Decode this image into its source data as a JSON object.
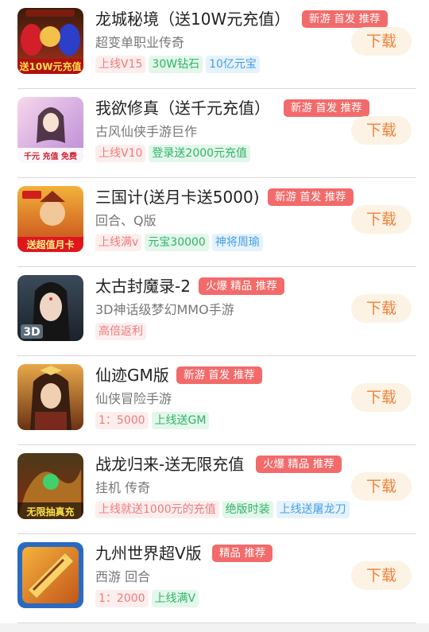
{
  "download_label": "下载",
  "games": [
    {
      "title": "龙城秘境（送10W元充值）",
      "badge": "新游 首发 推荐",
      "subtitle": "超变单职业传奇",
      "tags": [
        {
          "text": "上线V15",
          "color": "red"
        },
        {
          "text": "30W钻石",
          "color": "green"
        },
        {
          "text": "10亿元宝",
          "color": "blue"
        }
      ],
      "icon_caption": "送10W元充值",
      "icon_name": "longcheng-game-icon"
    },
    {
      "title": "我欲修真（送千元充值）",
      "badge": "新游 首发 推荐",
      "subtitle": "古风仙侠手游巨作",
      "tags": [
        {
          "text": "上线V10",
          "color": "red"
        },
        {
          "text": "登录送2000元充值",
          "color": "green"
        }
      ],
      "icon_caption": "千元 充值 免费",
      "icon_name": "xiuzhen-game-icon"
    },
    {
      "title": "三国计(送月卡送5000)",
      "badge": "新游 首发 推荐",
      "subtitle": "回合、Q版",
      "tags": [
        {
          "text": "上线满v",
          "color": "red"
        },
        {
          "text": "元宝30000",
          "color": "green"
        },
        {
          "text": "神将周瑜",
          "color": "blue"
        }
      ],
      "icon_caption": "送超值月卡",
      "icon_name": "sanguoji-game-icon"
    },
    {
      "title": "太古封魔录-2",
      "badge": "火爆 精品 推荐",
      "subtitle": "3D神话级梦幻MMO手游",
      "tags": [
        {
          "text": "高倍返利",
          "color": "red"
        }
      ],
      "icon_caption": "3D",
      "icon_name": "taigu-game-icon"
    },
    {
      "title": "仙迹GM版",
      "badge": "新游 首发 推荐",
      "subtitle": "仙侠冒险手游",
      "tags": [
        {
          "text": "1：5000",
          "color": "red"
        },
        {
          "text": "上线送GM",
          "color": "green"
        }
      ],
      "icon_caption": "",
      "icon_name": "xianji-game-icon"
    },
    {
      "title": "战龙归来-送无限充值",
      "badge": "火爆 精品 推荐",
      "subtitle": "挂机 传奇",
      "tags": [
        {
          "text": "上线就送1000元的充值",
          "color": "red"
        },
        {
          "text": "绝版时装",
          "color": "green"
        },
        {
          "text": "上线送屠龙刀",
          "color": "blue"
        }
      ],
      "icon_caption": "无限抽真充",
      "icon_name": "zhanlong-game-icon"
    },
    {
      "title": "九州世界超V版",
      "badge": "精品 推荐",
      "subtitle": "西游 回合",
      "tags": [
        {
          "text": "1：2000",
          "color": "red"
        },
        {
          "text": "上线满V",
          "color": "green"
        }
      ],
      "icon_caption": "",
      "icon_name": "jiuzhou-game-icon"
    }
  ]
}
